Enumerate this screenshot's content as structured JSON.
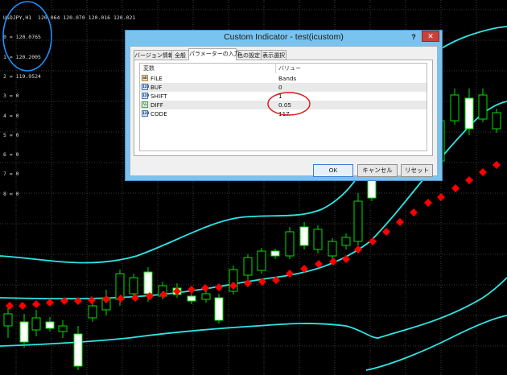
{
  "chart": {
    "readout_lines": [
      "USDJPY,H1  120.064 120.070 120.016 120.021",
      "0 = 120.0765",
      "1 = 120.2005",
      "2 = 119.9524",
      "3 = 0",
      "4 = 0",
      "5 = 0",
      "6 = 0",
      "7 = 0",
      "8 = 0"
    ],
    "colors": {
      "background": "#000000",
      "grid": "#4a4a4a",
      "bands": "#2fe6e6",
      "candle_outline": "#00e000",
      "candle_bull_body": "#000000",
      "candle_bear_body": "#ffffff",
      "markers": "#ff0000",
      "annotation_blue": "#1e90ff",
      "annotation_red": "#e01010"
    }
  },
  "dialog": {
    "title": "Custom Indicator - test(icustom)",
    "help_label": "?",
    "close_label": "✕",
    "tabs": [
      {
        "label": "バージョン情報"
      },
      {
        "label": "全般"
      },
      {
        "label": "パラメーターの入力"
      },
      {
        "label": "色の設定"
      },
      {
        "label": "表示選択"
      }
    ],
    "active_tab": "パラメーターの入力",
    "table": {
      "header_variable": "変数",
      "header_value": "バリュー",
      "rows": [
        {
          "icon": "string-icon",
          "icon_text": "ab",
          "name": "FILE",
          "value": "Bands"
        },
        {
          "icon": "integer-icon",
          "icon_text": "123",
          "name": "BUF",
          "value": "0"
        },
        {
          "icon": "integer-icon",
          "icon_text": "123",
          "name": "SHIFT",
          "value": "1"
        },
        {
          "icon": "double-icon",
          "icon_text": "½",
          "name": "DIFF",
          "value": "0.05"
        },
        {
          "icon": "integer-icon",
          "icon_text": "123",
          "name": "CODE",
          "value": "117"
        }
      ]
    },
    "buttons": {
      "ok": "OK",
      "cancel": "キャンセル",
      "reset": "リセット"
    }
  }
}
